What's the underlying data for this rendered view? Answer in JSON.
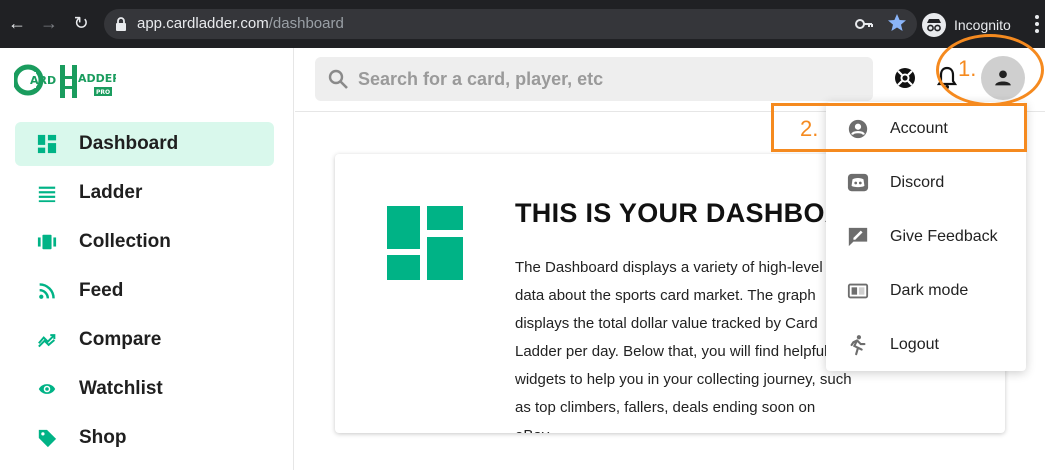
{
  "browser": {
    "url_host": "app.cardladder.com",
    "url_path": "/dashboard",
    "incognito_label": "Incognito"
  },
  "logo": {
    "text_top": "ARD",
    "text_right": "ADDER",
    "badge": "PRO",
    "brand_color": "#1a9c5e"
  },
  "sidebar": {
    "items": [
      {
        "label": "Dashboard",
        "icon": "dashboard-icon",
        "active": true
      },
      {
        "label": "Ladder",
        "icon": "list-icon"
      },
      {
        "label": "Collection",
        "icon": "collection-icon"
      },
      {
        "label": "Feed",
        "icon": "rss-feed-icon"
      },
      {
        "label": "Compare",
        "icon": "compare-icon"
      },
      {
        "label": "Watchlist",
        "icon": "eye-icon"
      },
      {
        "label": "Shop",
        "icon": "tag-icon"
      }
    ]
  },
  "topbar": {
    "search_placeholder": "Search for a card, player, etc"
  },
  "card": {
    "heading": "THIS IS YOUR DASHBOARD",
    "description": "The Dashboard displays a variety of high-level data about the sports card market. The graph displays the total dollar value tracked by Card Ladder per day. Below that, you will find helpful widgets to help you in your collecting journey, such as top climbers, fallers, deals ending soon on eBay."
  },
  "menu": {
    "items": [
      {
        "label": "Account",
        "icon": "account-circle-icon"
      },
      {
        "label": "Discord",
        "icon": "discord-icon"
      },
      {
        "label": "Give Feedback",
        "icon": "feedback-icon"
      },
      {
        "label": "Dark mode",
        "icon": "dark-mode-icon"
      },
      {
        "label": "Logout",
        "icon": "logout-icon"
      }
    ]
  },
  "annotations": {
    "step1": "1.",
    "step2": "2.",
    "color": "#f58a1f"
  },
  "colors": {
    "accent": "#00b386",
    "active_bg": "#d9f8ec"
  }
}
